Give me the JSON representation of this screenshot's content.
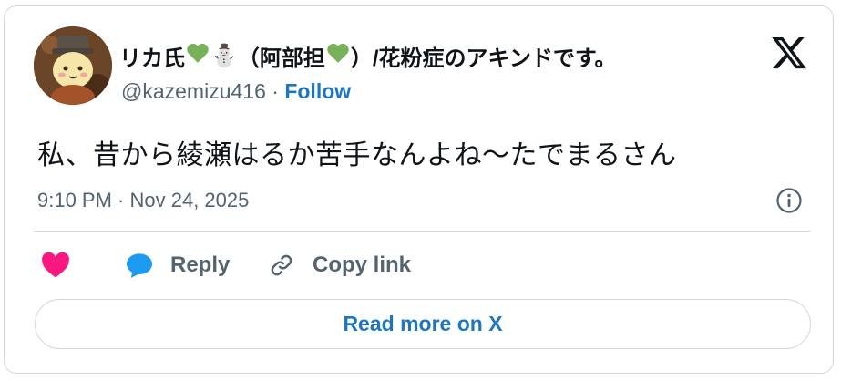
{
  "user": {
    "name_prefix": "リカ氏",
    "name_snowman": "⛄",
    "name_middle": "（阿部担",
    "name_suffix": "）/花粉症のアキンドです。",
    "handle": "@kazemizu416",
    "separator": " · ",
    "follow_label": "Follow"
  },
  "tweet": {
    "text": "私、昔から綾瀬はるか苦手なんよね〜たでまるさん",
    "timestamp": "9:10 PM · Nov 24, 2025"
  },
  "actions": {
    "like_label": "",
    "reply_label": "Reply",
    "copy_label": "Copy link"
  },
  "footer": {
    "read_more_label": "Read more on X"
  },
  "colors": {
    "like": "#f91880",
    "reply": "#1d9bf0",
    "link": "#1d76c2",
    "heart_green": "#78b159",
    "muted": "#536471",
    "border": "#cfd9de"
  },
  "icons": [
    "x-logo-icon",
    "info-icon",
    "heart-icon",
    "reply-bubble-icon",
    "link-icon",
    "green-heart-icon",
    "snowman-icon"
  ]
}
